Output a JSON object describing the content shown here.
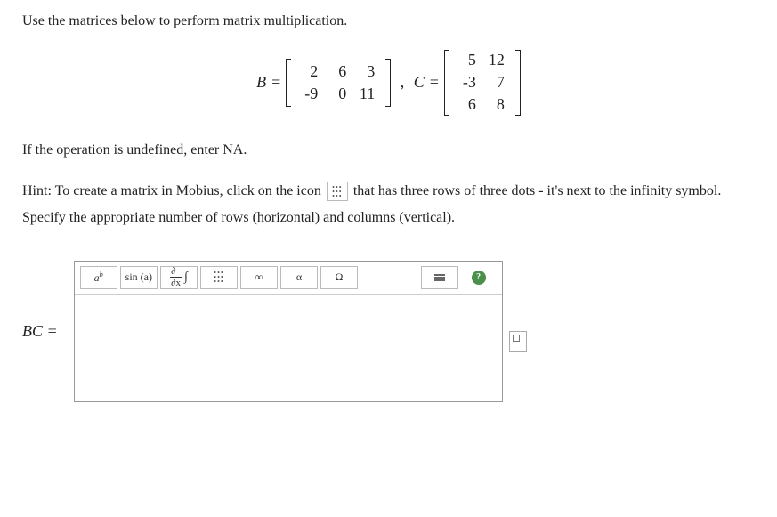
{
  "instruction": "Use the matrices below to perform matrix multiplication.",
  "matrices": {
    "B": {
      "label": "B",
      "rows": [
        [
          2,
          6,
          3
        ],
        [
          -9,
          0,
          11
        ]
      ]
    },
    "C": {
      "label": "C",
      "rows": [
        [
          5,
          12
        ],
        [
          -3,
          7
        ],
        [
          6,
          8
        ]
      ]
    }
  },
  "undefined_note": "If the operation is undefined, enter NA.",
  "hint_pre": "Hint: To create a matrix in Mobius, click on the icon",
  "hint_post1": "that has three rows of three dots - it's next to",
  "hint_post2": "the infinity symbol. Specify the appropriate number of rows (horizontal) and columns (vertical).",
  "answer_label": "BC =",
  "toolbar": {
    "exponent": "a",
    "exponent_sup": "b",
    "trig": "sin (a)",
    "deriv_top": "∂",
    "deriv_bot": "∂x",
    "integral": "∫",
    "infinity": "∞",
    "alpha": "α",
    "omega": "Ω",
    "help": "?"
  }
}
